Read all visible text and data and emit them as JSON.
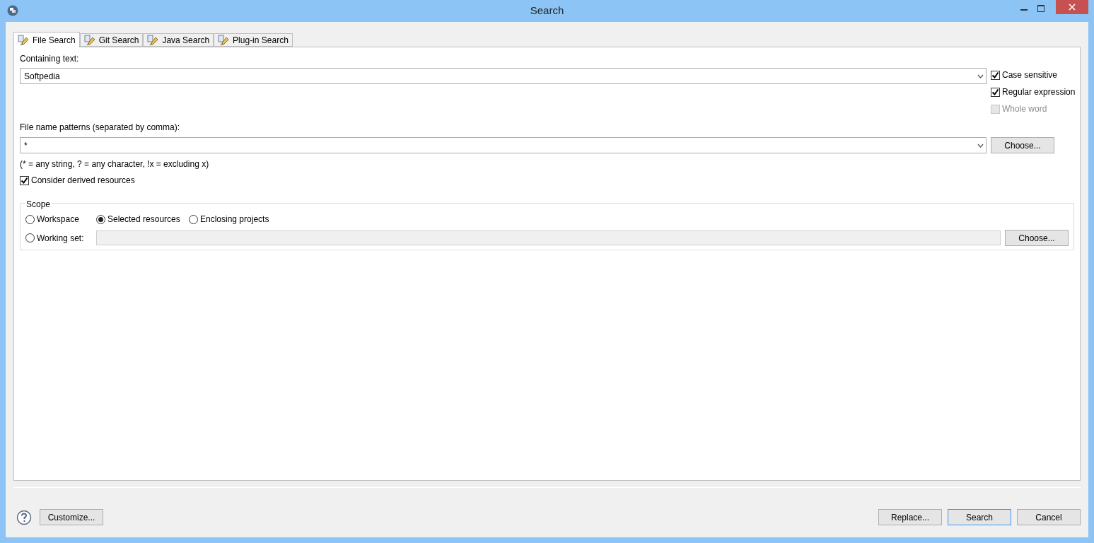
{
  "window": {
    "title": "Search"
  },
  "tabs": [
    {
      "label": "File Search",
      "selected": true
    },
    {
      "label": "Git Search",
      "selected": false
    },
    {
      "label": "Java Search",
      "selected": false
    },
    {
      "label": "Plug-in Search",
      "selected": false
    }
  ],
  "containing_text": {
    "label": "Containing text:",
    "value": "Softpedia"
  },
  "options": [
    {
      "label": "Case sensitive",
      "checked": true,
      "disabled": false
    },
    {
      "label": "Regular expression",
      "checked": true,
      "disabled": false
    },
    {
      "label": "Whole word",
      "checked": false,
      "disabled": true
    }
  ],
  "file_patterns": {
    "label": "File name patterns (separated by comma):",
    "value": "*",
    "button": "Choose...",
    "hint": "(* = any string, ? = any character, !x = excluding x)"
  },
  "derived": {
    "label": "Consider derived resources",
    "checked": true
  },
  "scope": {
    "title": "Scope",
    "radios": [
      {
        "label": "Workspace",
        "selected": false
      },
      {
        "label": "Selected resources",
        "selected": true
      },
      {
        "label": "Enclosing projects",
        "selected": false
      },
      {
        "label": "Working set:",
        "selected": false
      }
    ],
    "button": "Choose..."
  },
  "footer": {
    "left_button": "Customize...",
    "buttons": [
      {
        "label": "Replace...",
        "default": false
      },
      {
        "label": "Search",
        "default": true
      },
      {
        "label": "Cancel",
        "default": false
      }
    ]
  }
}
